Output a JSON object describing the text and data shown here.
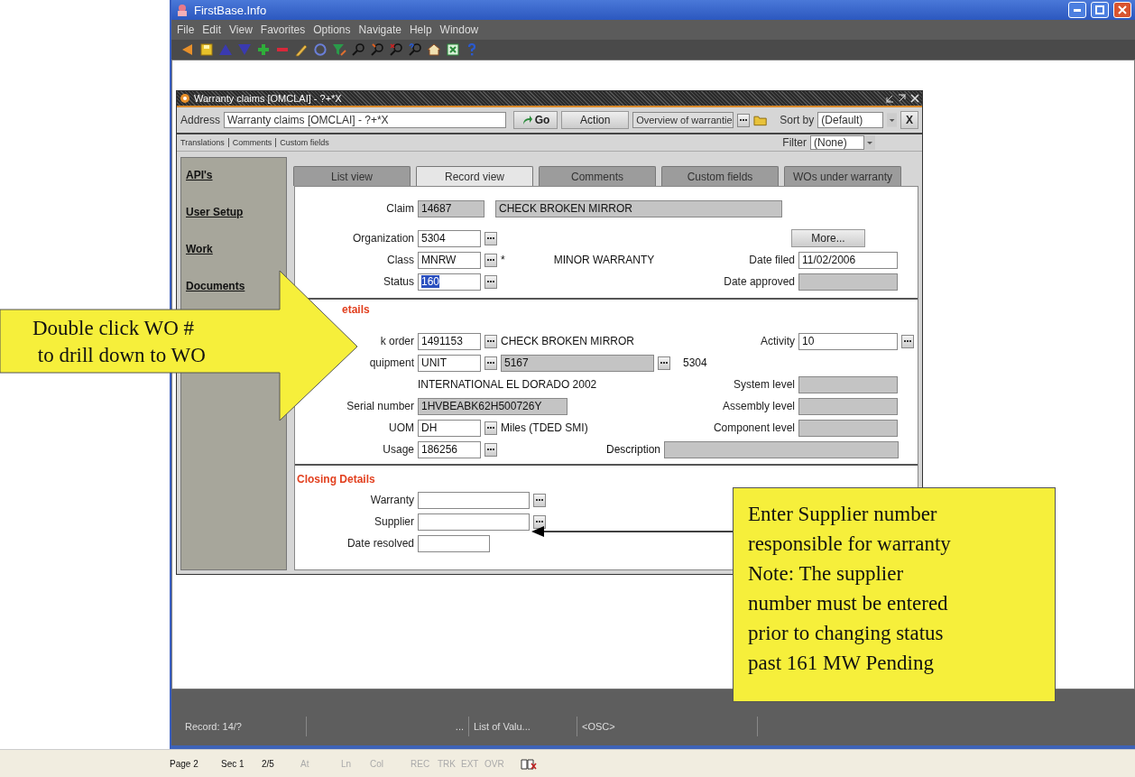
{
  "app_window": {
    "title": "FirstBase.Info"
  },
  "menu": [
    "File",
    "Edit",
    "View",
    "Favorites",
    "Options",
    "Navigate",
    "Help",
    "Window"
  ],
  "form_window": {
    "title": "Warranty claims [OMCLAI] - ?+*X",
    "address_label": "Address",
    "address_value": "Warranty claims [OMCLAI] -  ?+*X",
    "go_button": "Go",
    "action_button": "Action",
    "overview_value": "Overview of warrantie",
    "sort_label": "Sort by",
    "sort_value": "(Default)",
    "close_button": "X",
    "filter_label": "Filter",
    "filter_value": "(None)"
  },
  "links": [
    "Translations",
    "Comments",
    "Custom fields"
  ],
  "sidebar": [
    {
      "label": "API's"
    },
    {
      "label": "User Setup"
    },
    {
      "label": "Work"
    },
    {
      "label": "Documents"
    }
  ],
  "tabs": [
    {
      "label": "List view",
      "selected": false
    },
    {
      "label": "Record view",
      "selected": true
    },
    {
      "label": "Comments",
      "selected": false
    },
    {
      "label": "Custom fields",
      "selected": false
    },
    {
      "label": "WOs under warranty",
      "selected": false
    }
  ],
  "record": {
    "claim": {
      "label": "Claim",
      "value": "14687",
      "readonly": true
    },
    "claim_description": {
      "value": "CHECK BROKEN MIRROR",
      "readonly": true
    },
    "organization": {
      "label": "Organization",
      "value": "5304",
      "readonly": false
    },
    "more_button": "More...",
    "class": {
      "label": "Class",
      "value": "MNRW",
      "readonly": false
    },
    "class_required_mark": "*",
    "class_description": "MINOR WARRANTY",
    "date_filed": {
      "label": "Date filed",
      "value": "11/02/2006",
      "readonly": false
    },
    "status": {
      "label": "Status",
      "value": "160",
      "readonly": false,
      "highlighted": true
    },
    "date_approved": {
      "label": "Date approved",
      "readonly": true
    }
  },
  "details": {
    "heading": "etails",
    "work_order": {
      "label": "k order",
      "value": "1491153",
      "readonly": false
    },
    "work_order_description": "CHECK BROKEN MIRROR",
    "activity": {
      "label": "Activity",
      "value": "10",
      "readonly": false
    },
    "equipment": {
      "label": "quipment",
      "value": "UNIT",
      "readonly": false
    },
    "equipment_code": {
      "value": "5167",
      "readonly": true
    },
    "equipment_organization": "5304",
    "equipment_description": "INTERNATIONAL EL DORADO 2002",
    "system_level": {
      "label": "System level",
      "readonly": true
    },
    "serial_number": {
      "label": "Serial number",
      "value": "1HVBEABK62H500726Y",
      "readonly": true
    },
    "assembly_level": {
      "label": "Assembly level",
      "readonly": true
    },
    "uom": {
      "label": "UOM",
      "value": "DH",
      "readonly": false
    },
    "uom_description": "Miles (TDED SMI)",
    "component_level": {
      "label": "Component level",
      "readonly": true
    },
    "usage": {
      "label": "Usage",
      "value": "186256",
      "readonly": false
    },
    "description": {
      "label": "Description",
      "readonly": true
    }
  },
  "closing": {
    "heading": "Closing Details",
    "warranty": {
      "label": "Warranty",
      "readonly": false
    },
    "supplier": {
      "label": "Supplier",
      "readonly": false
    },
    "date_resolved": {
      "label": "Date resolved",
      "readonly": false
    }
  },
  "status_bar": [
    "Record: 14/?",
    "...",
    "List of Valu...",
    "<OSC>"
  ],
  "word_status": [
    {
      "text": "Page 2",
      "disabled": false
    },
    {
      "text": "Sec 1",
      "disabled": false
    },
    {
      "text": "2/5",
      "disabled": false
    },
    {
      "text": "At",
      "disabled": true
    },
    {
      "text": "Ln",
      "disabled": true
    },
    {
      "text": "Col",
      "disabled": true
    },
    {
      "text": "REC",
      "disabled": true
    },
    {
      "text": "TRK",
      "disabled": true
    },
    {
      "text": "EXT",
      "disabled": true
    },
    {
      "text": "OVR",
      "disabled": true
    }
  ],
  "callouts": [
    {
      "lines": [
        "Double click WO #",
        " to drill down to WO"
      ]
    },
    {
      "lines": [
        "Enter Supplier number",
        "responsible for warranty",
        "Note: The supplier",
        "number must be entered",
        "prior to changing status",
        "past 161 MW Pending"
      ]
    }
  ]
}
